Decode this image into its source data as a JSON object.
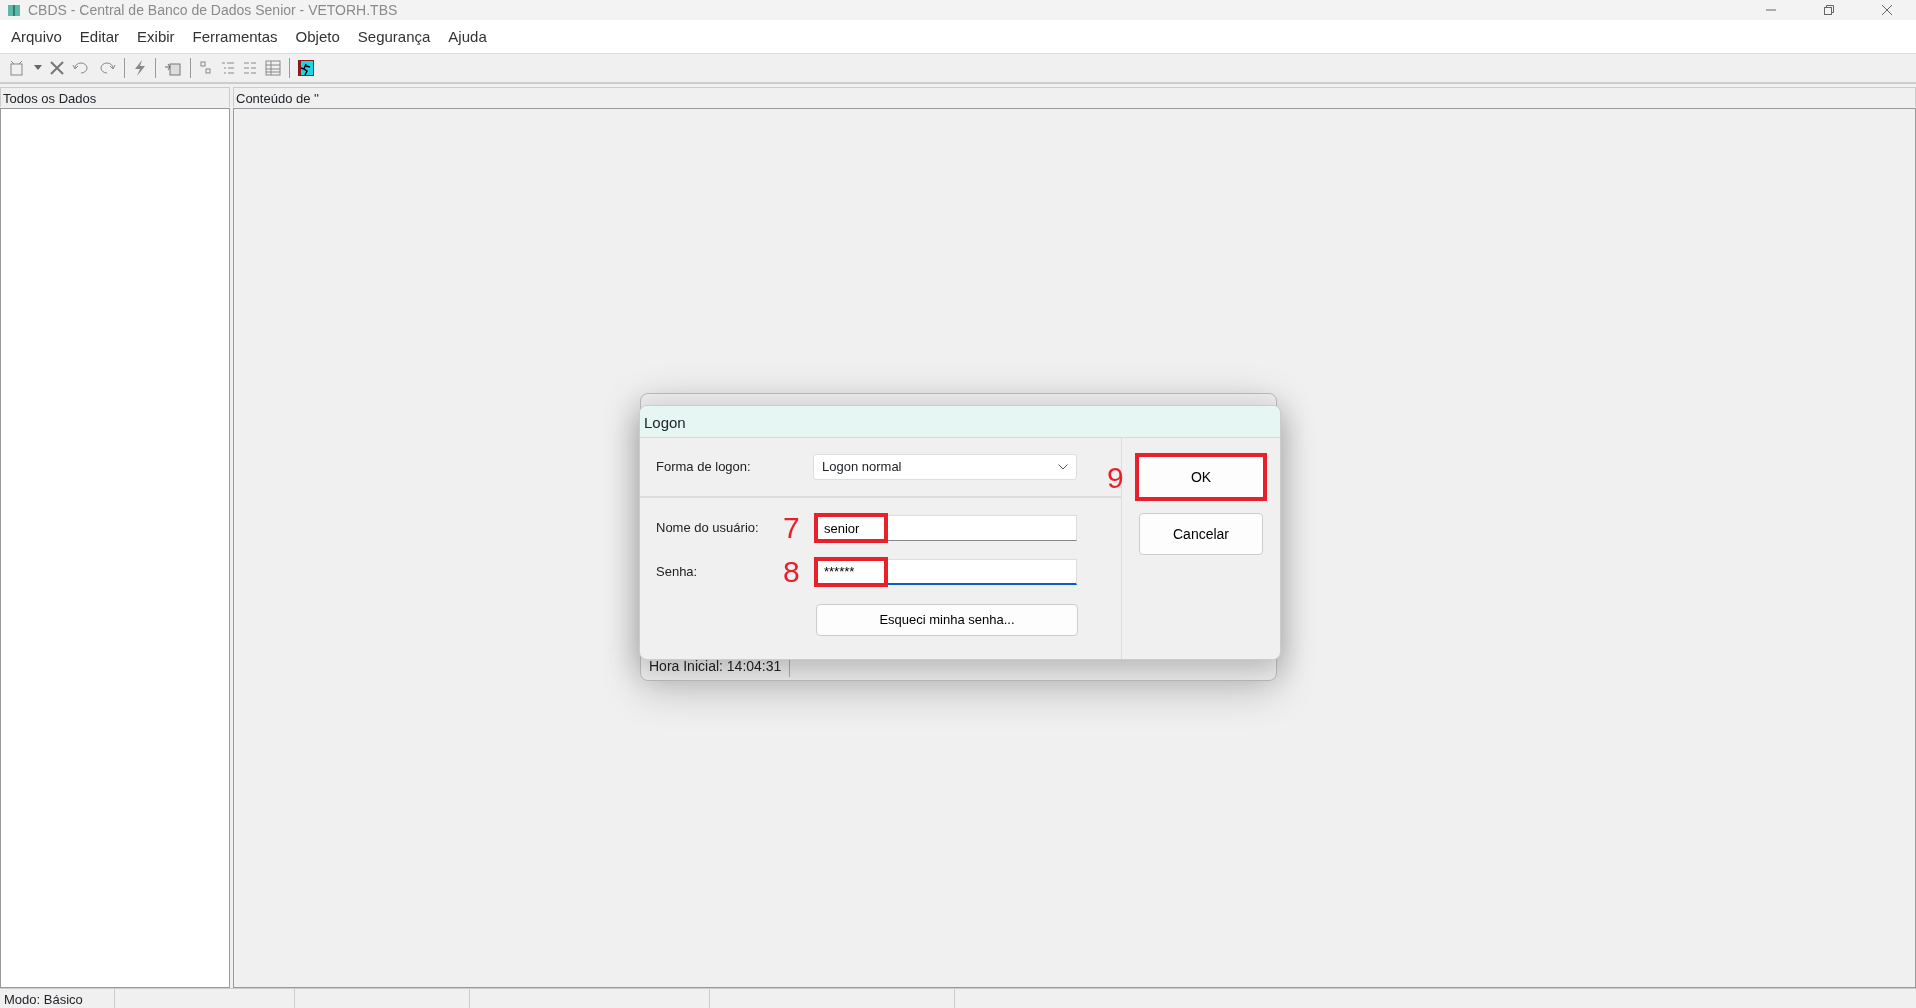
{
  "window": {
    "title": "CBDS - Central de Banco de Dados Senior - VETORH.TBS"
  },
  "menu": [
    {
      "label": "Arquivo"
    },
    {
      "label": "Editar"
    },
    {
      "label": "Exibir"
    },
    {
      "label": "Ferramentas"
    },
    {
      "label": "Objeto"
    },
    {
      "label": "Segurança"
    },
    {
      "label": "Ajuda"
    }
  ],
  "panels": {
    "left_header": "Todos os Dados",
    "right_header": "Conteúdo de ''"
  },
  "background_window": {
    "status": "Hora Inicial: 14:04:31"
  },
  "dialog": {
    "title": "Logon",
    "fields": [
      {
        "label": "Forma de logon:",
        "kind": "select",
        "value": "Logon normal"
      },
      {
        "label": "Nome do usuário:",
        "kind": "text",
        "value": "senior",
        "marker": "7",
        "highlighted": true,
        "focused": false
      },
      {
        "label": "Senha:",
        "kind": "text",
        "value": "******",
        "marker": "8",
        "highlighted": true,
        "focused": true
      }
    ],
    "forgot_button": "Esqueci minha senha...",
    "buttons": [
      {
        "label": "OK",
        "marker": "9",
        "highlighted": true
      },
      {
        "label": "Cancelar",
        "highlighted": false
      }
    ]
  },
  "status_bar": [
    "Modo: Básico"
  ]
}
